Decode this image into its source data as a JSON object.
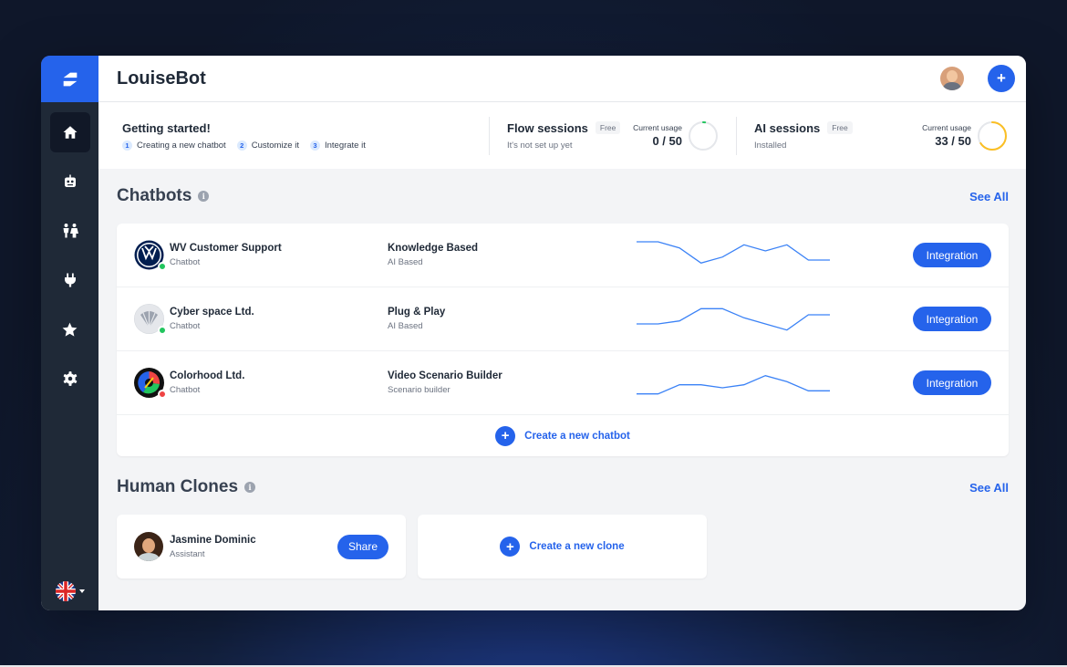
{
  "app": {
    "title": "LouiseBot"
  },
  "sidebar": {
    "items": [
      {
        "name": "home",
        "icon": "home-icon",
        "active": true
      },
      {
        "name": "bots",
        "icon": "robot-icon",
        "active": false
      },
      {
        "name": "human-clones",
        "icon": "people-icon",
        "active": false
      },
      {
        "name": "integrations",
        "icon": "plug-icon",
        "active": false
      },
      {
        "name": "favorites",
        "icon": "star-icon",
        "active": false
      },
      {
        "name": "settings",
        "icon": "gear-icon",
        "active": false
      }
    ],
    "language": {
      "flag": "uk-flag-icon"
    }
  },
  "header": {
    "add_label": "+"
  },
  "getting_started": {
    "title": "Getting started!",
    "steps": [
      {
        "num": "1",
        "label": "Creating a new chatbot"
      },
      {
        "num": "2",
        "label": "Customize it"
      },
      {
        "num": "3",
        "label": "Integrate it"
      }
    ]
  },
  "flow_sessions": {
    "title": "Flow sessions",
    "badge": "Free",
    "status": "It's not set up yet",
    "usage_label": "Current usage",
    "usage_value": "0 / 50",
    "used": 0,
    "limit": 50,
    "color": "#22c55e"
  },
  "ai_sessions": {
    "title": "AI sessions",
    "badge": "Free",
    "status": "Installed",
    "usage_label": "Current usage",
    "usage_value": "33 / 50",
    "used": 33,
    "limit": 50,
    "color": "#fbbf24"
  },
  "chatbots": {
    "title": "Chatbots",
    "see_all": "See All",
    "rows": [
      {
        "name": "WV Customer Support",
        "sub": "Chatbot",
        "type": "Knowledge Based",
        "type_sub": "AI Based",
        "button": "Integration",
        "logo": "vw-logo-icon",
        "status_color": "#22c55e",
        "trend": [
          9,
          9,
          7,
          2,
          4,
          8,
          6,
          8,
          3,
          3
        ]
      },
      {
        "name": "Cyber space Ltd.",
        "sub": "Chatbot",
        "type": "Plug & Play",
        "type_sub": "AI Based",
        "button": "Integration",
        "logo": "shell-logo-icon",
        "status_color": "#22c55e",
        "trend": [
          3,
          3,
          4,
          8,
          8,
          5,
          3,
          1,
          6,
          6
        ]
      },
      {
        "name": "Colorhood Ltd.",
        "sub": "Chatbot",
        "type": "Video Scenario Builder",
        "type_sub": "Scenario builder",
        "button": "Integration",
        "logo": "color-wheel-logo-icon",
        "status_color": "#ef4444",
        "trend": [
          1,
          1,
          4,
          4,
          3,
          4,
          7,
          5,
          2,
          2
        ]
      }
    ],
    "create_label": "Create a new chatbot"
  },
  "human_clones": {
    "title": "Human Clones",
    "see_all": "See All",
    "clones": [
      {
        "name": "Jasmine Dominic",
        "role": "Assistant",
        "button": "Share"
      }
    ],
    "create_label": "Create a new clone"
  },
  "colors": {
    "accent": "#2563eb",
    "sidebar": "#1f2937"
  }
}
